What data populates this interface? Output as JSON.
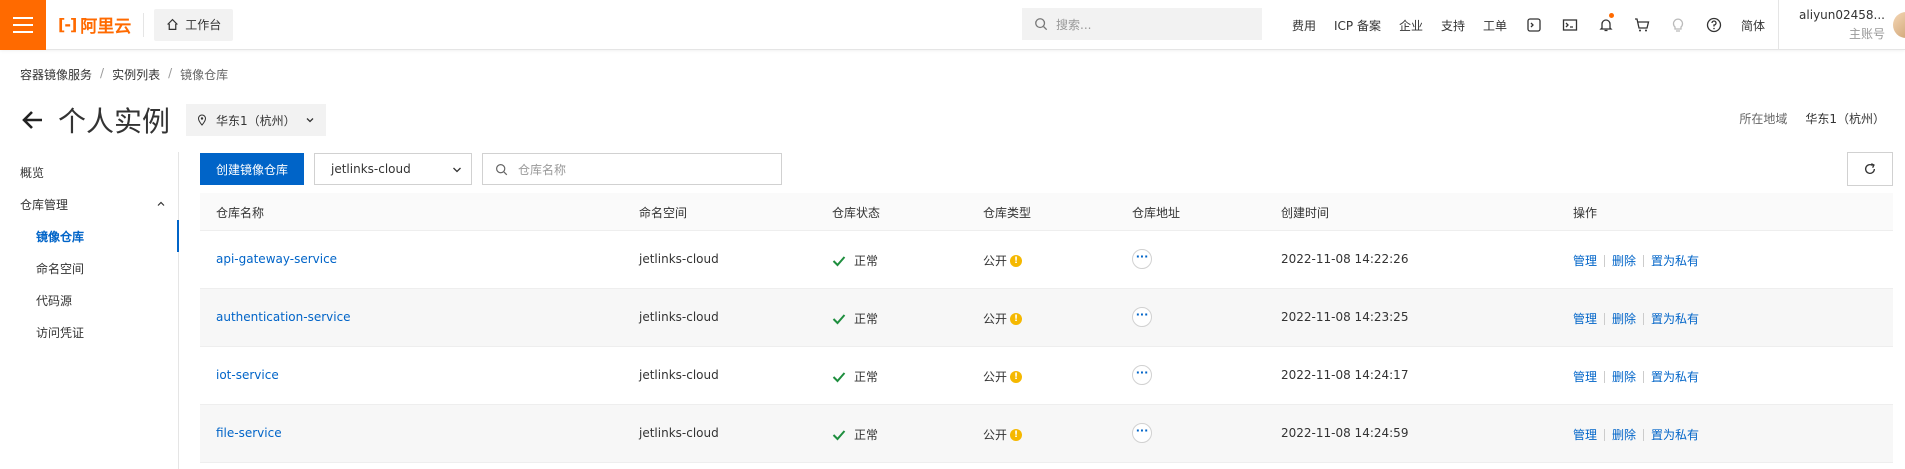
{
  "topbar": {
    "logo_text": "阿里云",
    "workbench_label": "工作台",
    "search_placeholder": "搜索...",
    "nav": [
      "费用",
      "ICP 备案",
      "企业",
      "支持",
      "工单"
    ],
    "lang": "简体",
    "user_name": "aliyun02458...",
    "user_role": "主账号"
  },
  "breadcrumb": [
    "容器镜像服务",
    "实例列表",
    "镜像仓库"
  ],
  "page": {
    "title": "个人实例",
    "region_select": "华东1（杭州）",
    "region_label": "所在地域",
    "region_value": "华东1（杭州）"
  },
  "sidebar": {
    "overview": "概览",
    "group": "仓库管理",
    "items": [
      "镜像仓库",
      "命名空间",
      "代码源",
      "访问凭证"
    ]
  },
  "toolbar": {
    "create_label": "创建镜像仓库",
    "namespace_value": "jetlinks-cloud",
    "name_placeholder": "仓库名称"
  },
  "table": {
    "headers": [
      "仓库名称",
      "命名空间",
      "仓库状态",
      "仓库类型",
      "仓库地址",
      "创建时间",
      "操作"
    ],
    "rows": [
      {
        "name": "api-gateway-service",
        "namespace": "jetlinks-cloud",
        "status": "正常",
        "type": "公开",
        "created": "2022-11-08 14:22:26"
      },
      {
        "name": "authentication-service",
        "namespace": "jetlinks-cloud",
        "status": "正常",
        "type": "公开",
        "created": "2022-11-08 14:23:25"
      },
      {
        "name": "iot-service",
        "namespace": "jetlinks-cloud",
        "status": "正常",
        "type": "公开",
        "created": "2022-11-08 14:24:17"
      },
      {
        "name": "file-service",
        "namespace": "jetlinks-cloud",
        "status": "正常",
        "type": "公开",
        "created": "2022-11-08 14:24:59"
      }
    ],
    "ops": [
      "管理",
      "删除",
      "置为私有"
    ]
  },
  "colors": {
    "brand": "#ff6a00",
    "primary": "#0064c8",
    "success": "#1e8e3e",
    "warning": "#f5b800"
  }
}
